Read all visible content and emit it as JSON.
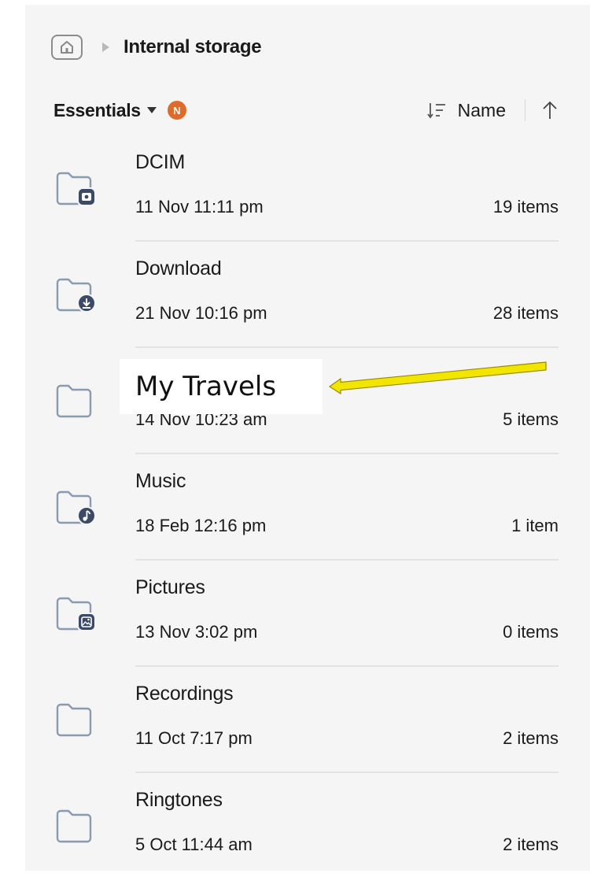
{
  "breadcrumb": {
    "home_icon": "home-icon",
    "label": "Internal storage"
  },
  "header": {
    "filter_label": "Essentials",
    "badge_text": "N",
    "sort_label": "Name",
    "sort_icon": "sort-lines-icon",
    "direction_icon": "arrow-up-icon",
    "badge_color": "#e06a2a"
  },
  "folders": [
    {
      "name": "DCIM",
      "date": "11 Nov 11:11 pm",
      "count": "19 items",
      "icon": "folder-camera-icon"
    },
    {
      "name": "Download",
      "date": "21 Nov 10:16 pm",
      "count": "28 items",
      "icon": "folder-download-icon"
    },
    {
      "name": "",
      "date": "14 Nov 10:23 am",
      "count": "5 items",
      "icon": "folder-icon"
    },
    {
      "name": "Music",
      "date": "18 Feb 12:16 pm",
      "count": "1 item",
      "icon": "folder-music-icon"
    },
    {
      "name": "Pictures",
      "date": "13 Nov 3:02 pm",
      "count": "0 items",
      "icon": "folder-image-icon"
    },
    {
      "name": "Recordings",
      "date": "11 Oct 7:17 pm",
      "count": "2 items",
      "icon": "folder-icon"
    },
    {
      "name": "Ringtones",
      "date": "5 Oct 11:44 am",
      "count": "2 items",
      "icon": "folder-icon"
    }
  ],
  "annotation": {
    "text": "My Travels",
    "arrow_color": "#f2e600"
  },
  "colors": {
    "folder_outline": "#8a9bb0",
    "badge_fill": "#3b4a66"
  }
}
